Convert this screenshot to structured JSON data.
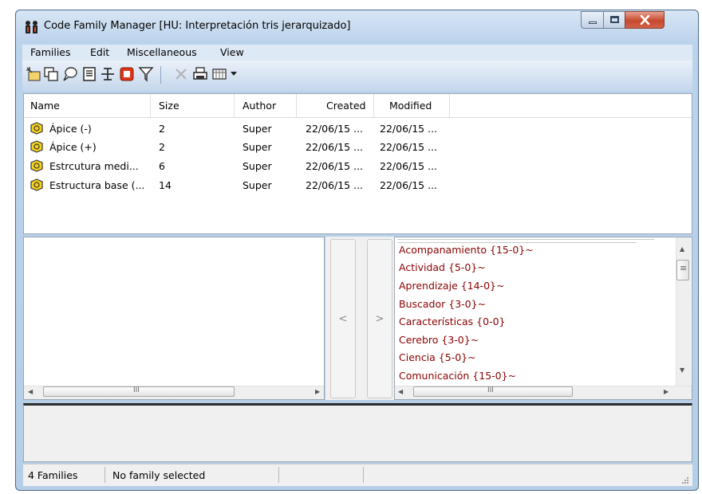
{
  "window": {
    "title": "Code Family Manager [HU: Interpretación tris jerarquizado]"
  },
  "menu": [
    "Families",
    "Edit",
    "Miscellaneous",
    "View"
  ],
  "toolbar": {
    "icons": [
      "new-family-icon",
      "duplicate-icon",
      "comment-icon",
      "properties-icon",
      "tree-icon",
      "stop-icon",
      "filter-icon",
      "delete-icon",
      "print-icon",
      "view-icon",
      "dropdown-icon"
    ]
  },
  "table": {
    "columns": [
      "Name",
      "Size",
      "Author",
      "Created",
      "Modified"
    ],
    "rows": [
      {
        "name": "Ápice (-)",
        "size": "2",
        "author": "Super",
        "created": "22/06/15 ...",
        "modified": "22/06/15 ..."
      },
      {
        "name": "Ápice (+)",
        "size": "2",
        "author": "Super",
        "created": "22/06/15 ...",
        "modified": "22/06/15 ..."
      },
      {
        "name": "Estrcutura medi...",
        "size": "6",
        "author": "Super",
        "created": "22/06/15 ...",
        "modified": "22/06/15 ..."
      },
      {
        "name": "Estructura base (...",
        "size": "14",
        "author": "Super",
        "created": "22/06/15 ...",
        "modified": "22/06/15 ..."
      }
    ]
  },
  "nav": {
    "left": "<",
    "right": ">"
  },
  "codes": [
    "Acompanamiento {15-0}~",
    "Actividad {5-0}~",
    "Aprendizaje {14-0}~",
    "Buscador {3-0}~",
    "Características {0-0}",
    "Cerebro {3-0}~",
    "Ciencia {5-0}~",
    "Comunicación {15-0}~"
  ],
  "scroll": {
    "left_arrow": "◀",
    "right_arrow": "▶",
    "up_arrow": "▲",
    "down_arrow": "▼",
    "grip": "III",
    "vgrip": "≡"
  },
  "status": {
    "count": "4 Families",
    "selection": "No family selected"
  },
  "colors": {
    "code_text": "#8b0000",
    "close_button": "#c7482c"
  }
}
